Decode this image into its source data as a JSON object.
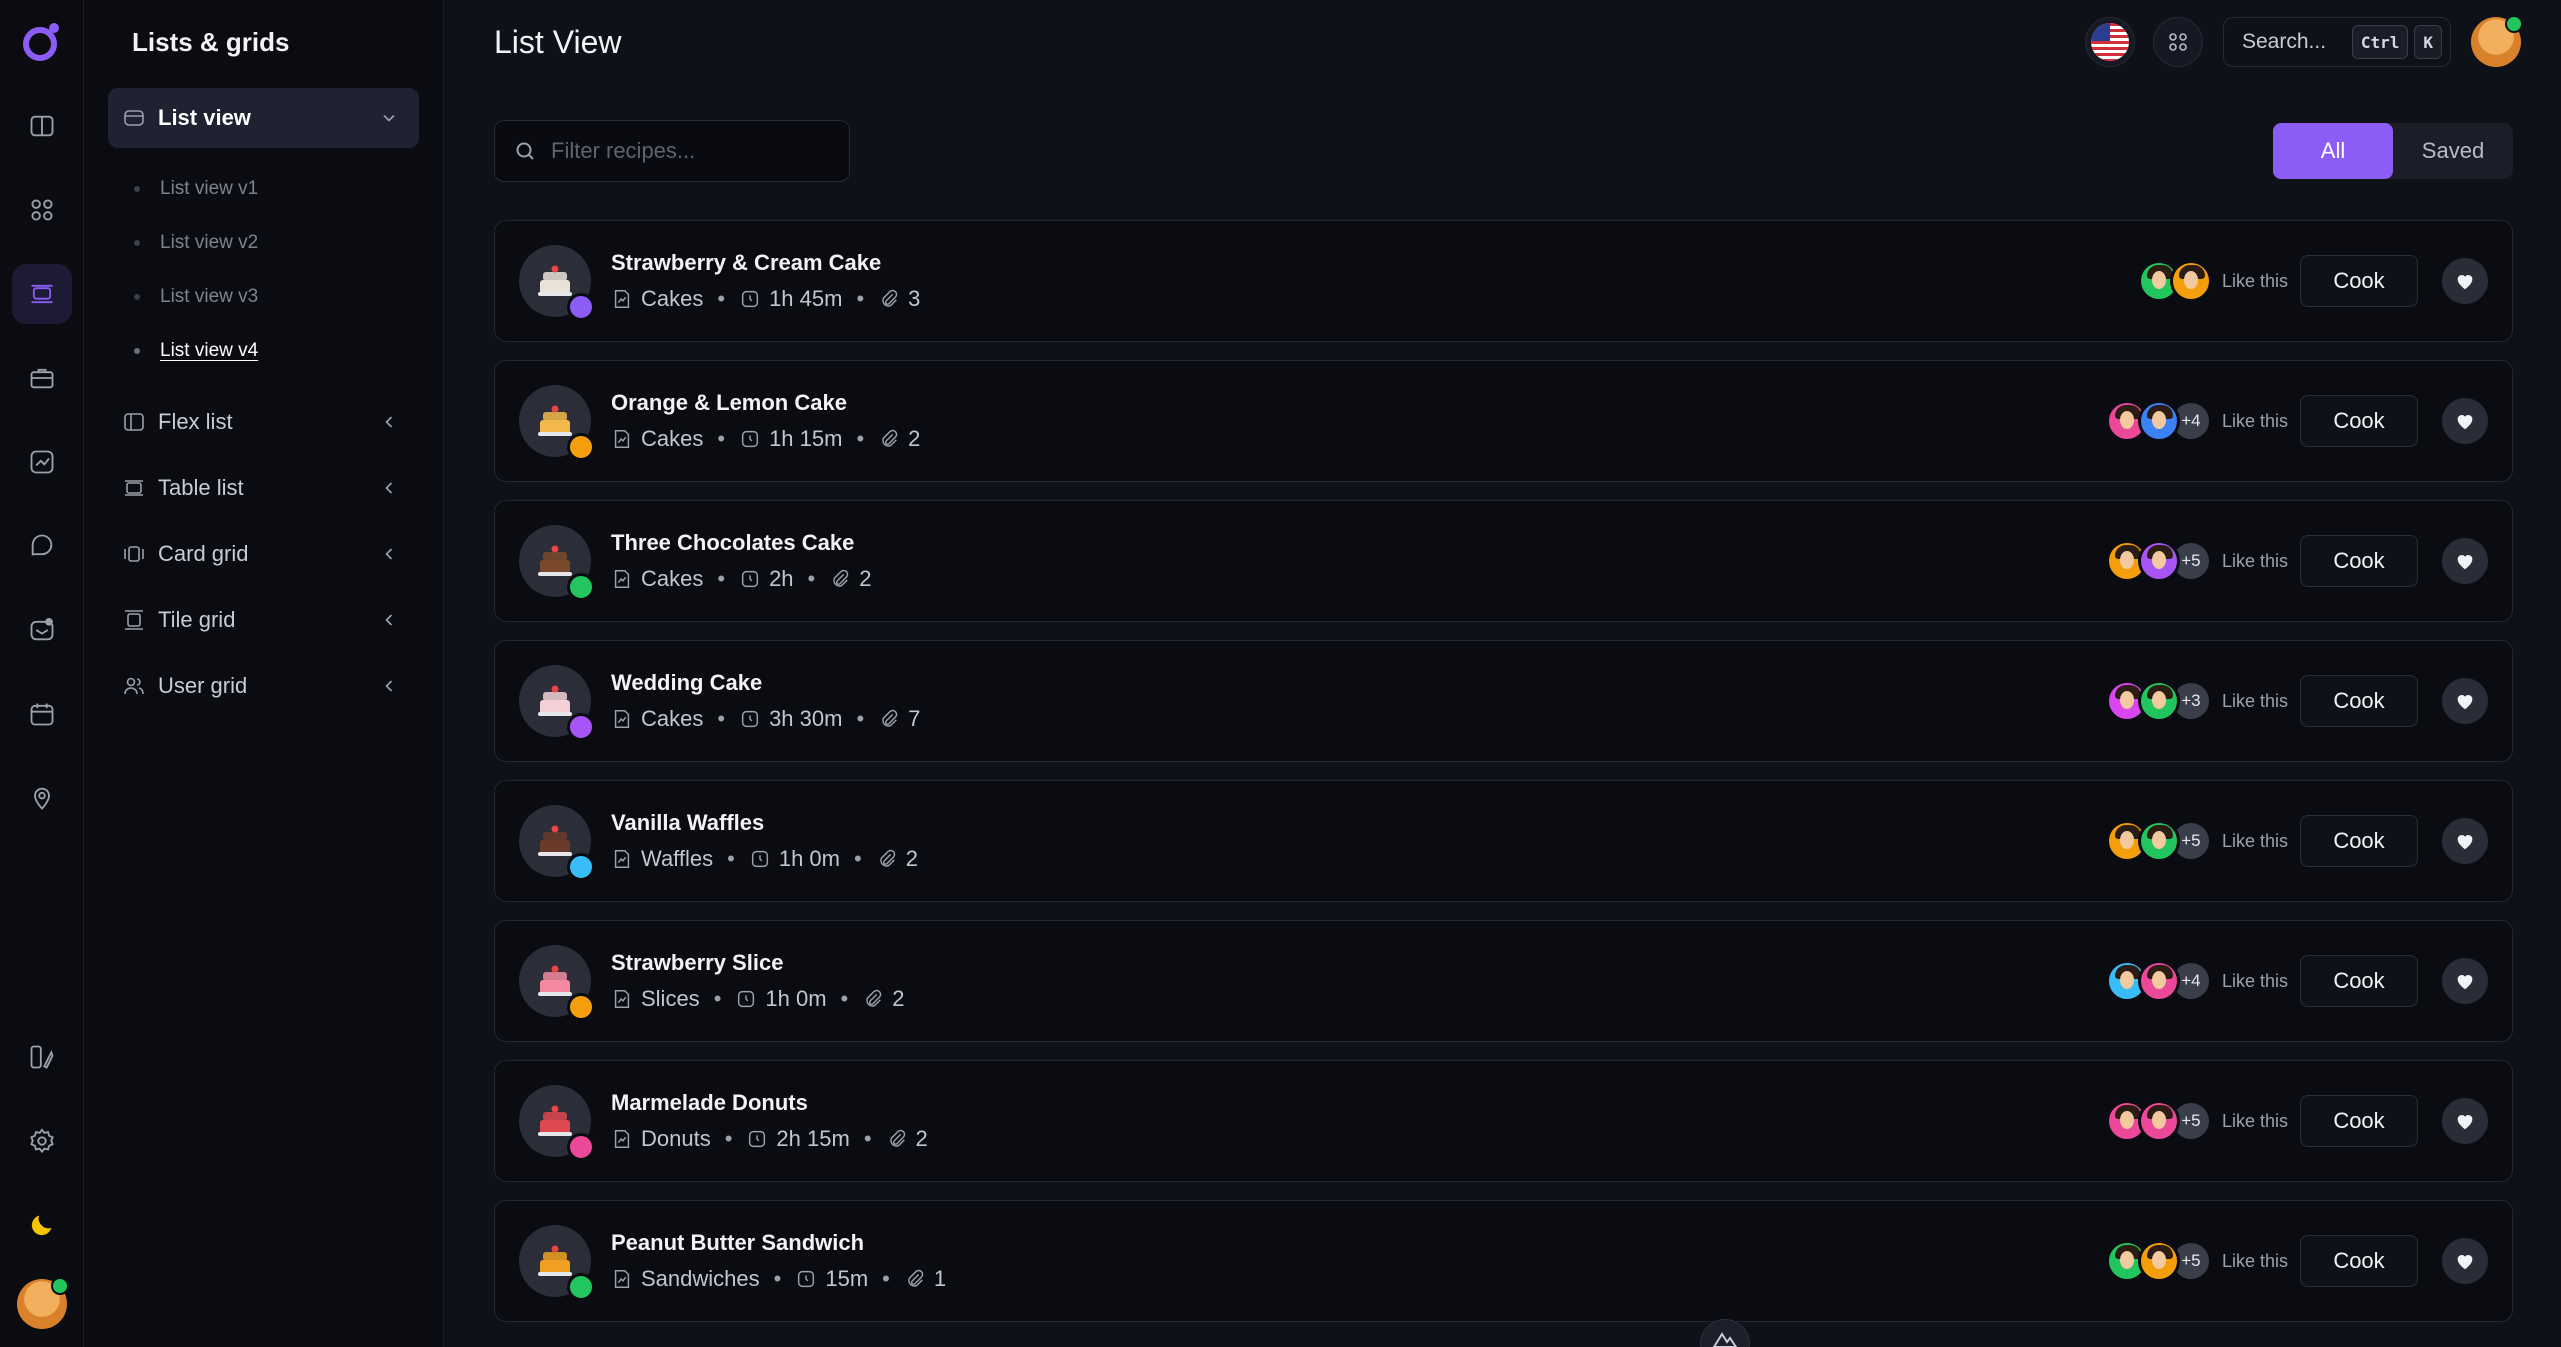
{
  "sidebar": {
    "title": "Lists & grids",
    "groups": [
      {
        "label": "List view",
        "open": true,
        "items": [
          "List view v1",
          "List view v2",
          "List view v3",
          "List view v4"
        ],
        "current": "List view v4"
      },
      {
        "label": "Flex list"
      },
      {
        "label": "Table list"
      },
      {
        "label": "Card grid"
      },
      {
        "label": "Tile grid"
      },
      {
        "label": "User grid"
      }
    ]
  },
  "header": {
    "title": "List View",
    "search_label": "Search...",
    "kbd_ctrl": "Ctrl",
    "kbd_k": "K"
  },
  "toolbar": {
    "filter_placeholder": "Filter recipes...",
    "tab_all": "All",
    "tab_saved": "Saved"
  },
  "colors": {
    "accent": "#8b5cf6",
    "background": "#0f1118",
    "card": "#0b0c12"
  },
  "recipes": [
    {
      "name": "Strawberry & Cream Cake",
      "category": "Cakes",
      "time": "1h 45m",
      "files": "3",
      "more": "",
      "like": "Like this",
      "action": "Cook",
      "thumb_color": "#e9e2d8",
      "badge": "#8b5cf6",
      "avatars": [
        "#22c55e",
        "#f59e0b"
      ]
    },
    {
      "name": "Orange & Lemon Cake",
      "category": "Cakes",
      "time": "1h 15m",
      "files": "2",
      "more": "+4",
      "like": "Like this",
      "action": "Cook",
      "thumb_color": "#f2b84b",
      "badge": "#f59e0b",
      "avatars": [
        "#ec4899",
        "#3b82f6"
      ]
    },
    {
      "name": "Three Chocolates Cake",
      "category": "Cakes",
      "time": "2h",
      "files": "2",
      "more": "+5",
      "like": "Like this",
      "action": "Cook",
      "thumb_color": "#7a4a2a",
      "badge": "#22c55e",
      "avatars": [
        "#f59e0b",
        "#a855f7"
      ]
    },
    {
      "name": "Wedding Cake",
      "category": "Cakes",
      "time": "3h 30m",
      "files": "7",
      "more": "+3",
      "like": "Like this",
      "action": "Cook",
      "thumb_color": "#f3d0d6",
      "badge": "#a855f7",
      "avatars": [
        "#d946ef",
        "#22c55e"
      ]
    },
    {
      "name": "Vanilla Waffles",
      "category": "Waffles",
      "time": "1h 0m",
      "files": "2",
      "more": "+5",
      "like": "Like this",
      "action": "Cook",
      "thumb_color": "#6b3a2a",
      "badge": "#38bdf8",
      "avatars": [
        "#f59e0b",
        "#22c55e"
      ]
    },
    {
      "name": "Strawberry Slice",
      "category": "Slices",
      "time": "1h 0m",
      "files": "2",
      "more": "+4",
      "like": "Like this",
      "action": "Cook",
      "thumb_color": "#f48aa0",
      "badge": "#f59e0b",
      "avatars": [
        "#38bdf8",
        "#ec4899"
      ]
    },
    {
      "name": "Marmelade Donuts",
      "category": "Donuts",
      "time": "2h 15m",
      "files": "2",
      "more": "+5",
      "like": "Like this",
      "action": "Cook",
      "thumb_color": "#e0484f",
      "badge": "#ec4899",
      "avatars": [
        "#ec4899",
        "#ec4899"
      ]
    },
    {
      "name": "Peanut Butter Sandwich",
      "category": "Sandwiches",
      "time": "15m",
      "files": "1",
      "more": "+5",
      "like": "Like this",
      "action": "Cook",
      "thumb_color": "#f0a020",
      "badge": "#22c55e",
      "avatars": [
        "#22c55e",
        "#f59e0b"
      ]
    }
  ]
}
